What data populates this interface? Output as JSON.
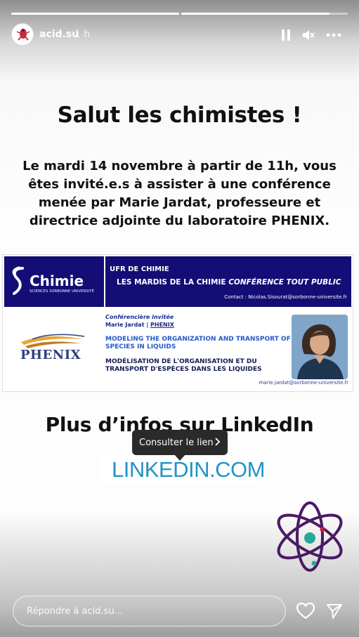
{
  "progress": {
    "segments": [
      {
        "fill": 1.0
      },
      {
        "fill": 0.89
      }
    ]
  },
  "header": {
    "username": "acid.su",
    "time_ago": "1 h"
  },
  "story": {
    "title": "Salut les chimistes !",
    "intro_lines": [
      "Le mardi 14 novembre à partir de 11h, vous",
      "êtes invité.e.s à assister à une conférence",
      "menée par Marie Jardat, professeure et",
      "directrice adjointe du laboratoire PHENIX."
    ],
    "flyer": {
      "brand": "Chimie",
      "brand_sub": "SCIENCES SORBONNE UNIVERSITÉ",
      "ufr": "UFR DE CHIMIE",
      "series": "LES MARDIS DE LA CHIMIE",
      "series_em": "CONFÉRENCE TOUT PUBLIC",
      "contact": "Contact : Nicolas.Sisourat@sorbonne-universite.fr",
      "lab": "PHENIX",
      "invited": "Conférencière invitée",
      "speaker": "Marie Jardat | ",
      "speaker_link": "PHENIX",
      "title_en": "MODELING THE ORGANIZATION AND TRANSPORT OF SPECIES IN LIQUIDS",
      "title_fr": "MODÉLISATION DE L'ORGANISATION ET DU TRANSPORT D'ESPÈCES DANS LES LIQUIDES",
      "email": "marie.jardat@sorbonne-universite.fr"
    },
    "more_info": "Plus d’infos sur LinkedIn",
    "tooltip": "Consulter le lien",
    "link_label": "LINKEDIN.COM"
  },
  "footer": {
    "reply_placeholder": "Répondre à acid.su..."
  },
  "colors": {
    "flyer_navy": "#140d75",
    "link_blue": "#2193c7",
    "atom_purple": "#4a1a64",
    "atom_teal": "#2aa79b",
    "atom_red": "#c0203a"
  }
}
